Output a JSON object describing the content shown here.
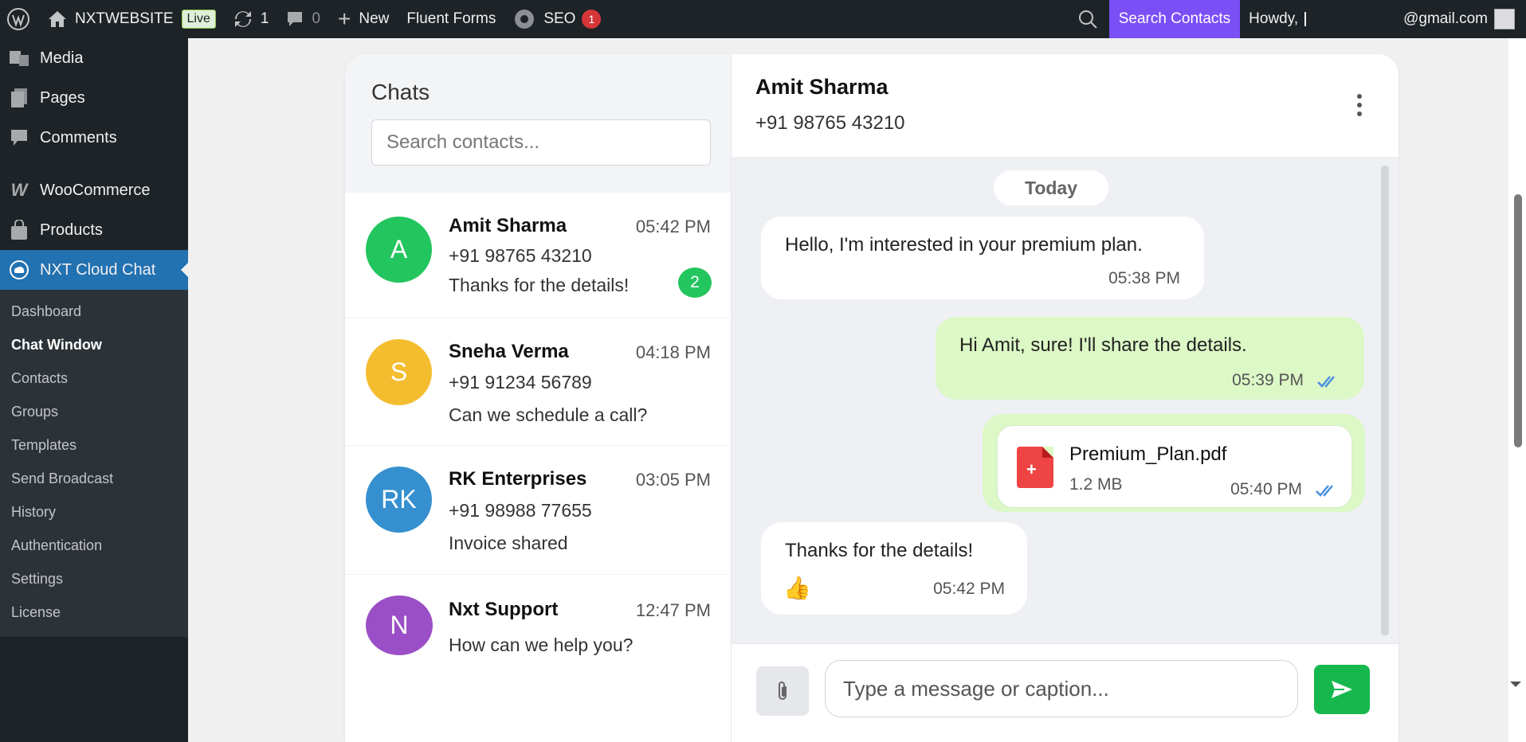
{
  "admin_bar": {
    "site_name": "NXTWEBSITE",
    "live_badge": "Live",
    "updates_count": "1",
    "comments_count": "0",
    "new_label": "New",
    "fluent_forms": "Fluent Forms",
    "seo_label": "SEO",
    "seo_count": "1",
    "search_contacts": "Search Contacts",
    "howdy": "Howdy,",
    "user_email": "@gmail.com"
  },
  "sidebar": {
    "items": [
      {
        "label": "Media",
        "icon": "media-icon"
      },
      {
        "label": "Pages",
        "icon": "pages-icon"
      },
      {
        "label": "Comments",
        "icon": "comments-icon"
      },
      {
        "label": "WooCommerce",
        "icon": "woocommerce-icon"
      },
      {
        "label": "Products",
        "icon": "products-icon"
      },
      {
        "label": "NXT Cloud Chat",
        "icon": "cloud-chat-icon"
      }
    ],
    "submenu": [
      "Dashboard",
      "Chat Window",
      "Contacts",
      "Groups",
      "Templates",
      "Send Broadcast",
      "History",
      "Authentication",
      "Settings",
      "License"
    ]
  },
  "contacts_pane": {
    "title": "Chats",
    "search_placeholder": "Search contacts...",
    "contacts": [
      {
        "initials": "A",
        "name": "Amit Sharma",
        "time": "05:42 PM",
        "phone": "+91 98765 43210",
        "message": "Thanks for the details!",
        "unread": "2",
        "color": "#22c55e"
      },
      {
        "initials": "S",
        "name": "Sneha Verma",
        "time": "04:18 PM",
        "phone": "+91 91234 56789",
        "message": "Can we schedule a call?",
        "color": "#f4bd2f"
      },
      {
        "initials": "RK",
        "name": "RK Enterprises",
        "time": "03:05 PM",
        "phone": "+91 98988 77655",
        "message": "Invoice shared",
        "color": "#3690cf"
      },
      {
        "initials": "N",
        "name": "Nxt Support",
        "time": "12:47 PM",
        "message": "How can we help you?",
        "color": "#9b4fc6"
      }
    ]
  },
  "conversation": {
    "name": "Amit Sharma",
    "phone": "+91 98765 43210",
    "date_separator": "Today",
    "messages": [
      {
        "text": "Hello, I'm interested in your premium plan.",
        "time": "05:38 PM",
        "direction": "in"
      },
      {
        "text": "Hi Amit, sure! I'll share the details.",
        "time": "05:39 PM",
        "direction": "out"
      },
      {
        "file_name": "Premium_Plan.pdf",
        "file_size": "1.2 MB",
        "time": "05:40 PM",
        "direction": "out"
      },
      {
        "text": "Thanks for the details!",
        "emoji": "👍",
        "time": "05:42 PM",
        "direction": "in"
      }
    ],
    "composer_placeholder": "Type a message or caption..."
  },
  "colors": {
    "admin_bg": "#1d2327",
    "active_menu": "#2271b1",
    "search_contacts_bg": "#7b4ff6",
    "outgoing_bubble": "#dcf8c6",
    "send_button": "#16b84e"
  }
}
